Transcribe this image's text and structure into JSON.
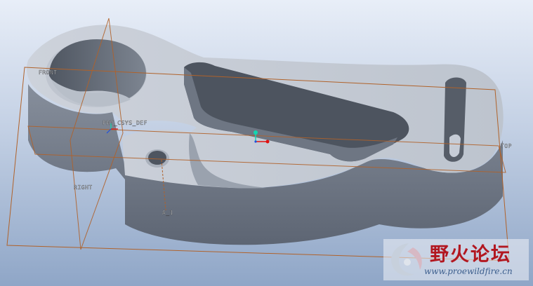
{
  "datum_planes": {
    "front": "FRONT",
    "right": "RIGHT",
    "top": "TOP"
  },
  "csys_label": "PRT_CSYS_DEF",
  "axis_label": "A_1",
  "watermark": {
    "title": "野火论坛",
    "url": "www.proewildfire.cn"
  },
  "colors": {
    "datum_line": "#b0622a",
    "part_top": "#c6ccd6",
    "part_side": "#6b7380",
    "background_top": "#e8eef8",
    "background_bottom": "#8fa6c7",
    "csys_x": "#e01010",
    "csys_y": "#13d6b0",
    "csys_z": "#2050e0"
  }
}
